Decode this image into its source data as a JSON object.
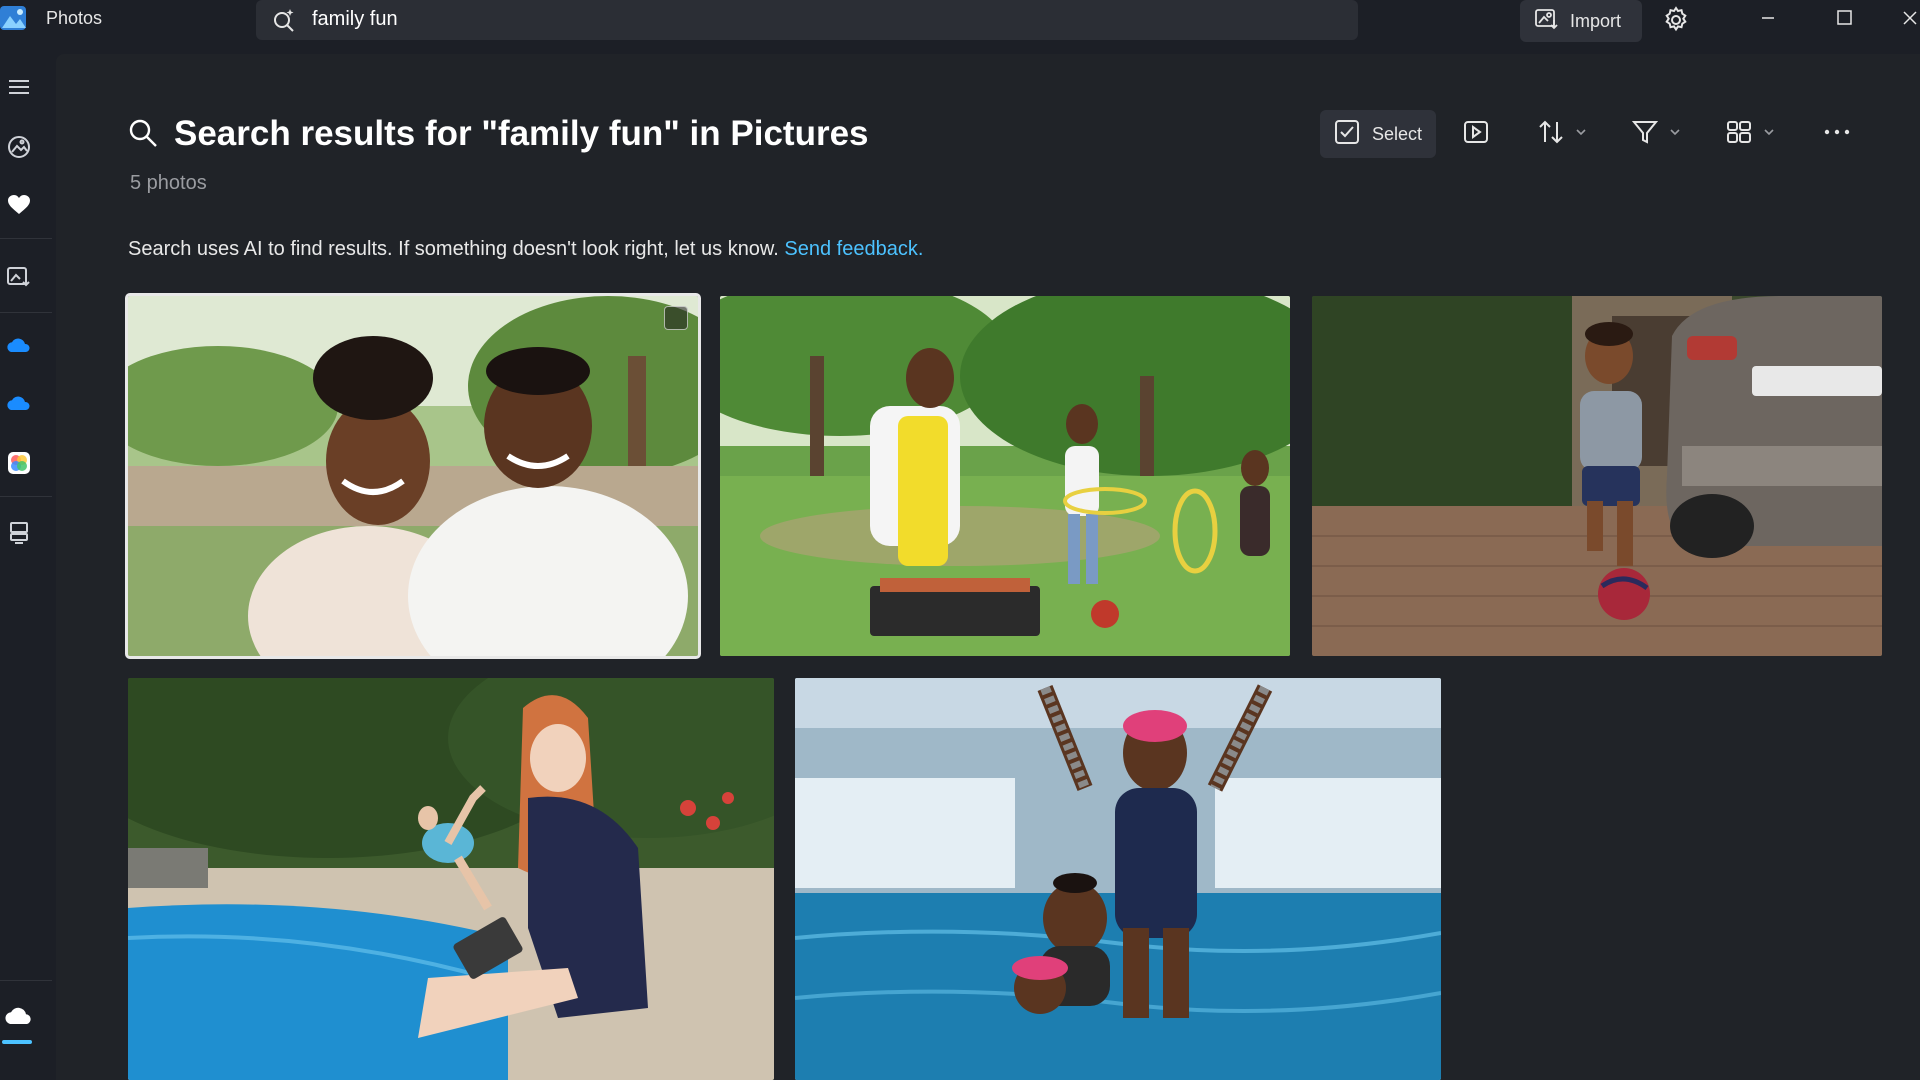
{
  "app": {
    "name": "Photos"
  },
  "titlebar": {
    "search_value": "family fun",
    "import_label": "Import"
  },
  "header": {
    "title": "Search results for \"family fun\" in Pictures",
    "count": "5 photos"
  },
  "notice": {
    "text": "Search uses AI to find results. If something doesn't look right, let us know.",
    "link_label": "Send feedback."
  },
  "toolbar": {
    "select_label": "Select"
  },
  "rail": {
    "items": [
      "menu-icon",
      "gallery-icon",
      "favorites-heart-icon",
      "import-icon",
      "onedrive-icon",
      "onedrive-folder-icon",
      "apple-icloud-icon",
      "external-device-icon",
      "cloud-icon"
    ]
  },
  "photos": [
    {
      "name": "couple-hugging-outdoors"
    },
    {
      "name": "family-barbecue-hula-hoop"
    },
    {
      "name": "boy-with-soccer-ball"
    },
    {
      "name": "woman-laptop-by-pool"
    },
    {
      "name": "girls-swimming-pool"
    }
  ],
  "colors": {
    "background": "#1c1f26",
    "panel": "#202328",
    "accent_link": "#4cc2ff",
    "muted_text": "#9a9ca1"
  }
}
